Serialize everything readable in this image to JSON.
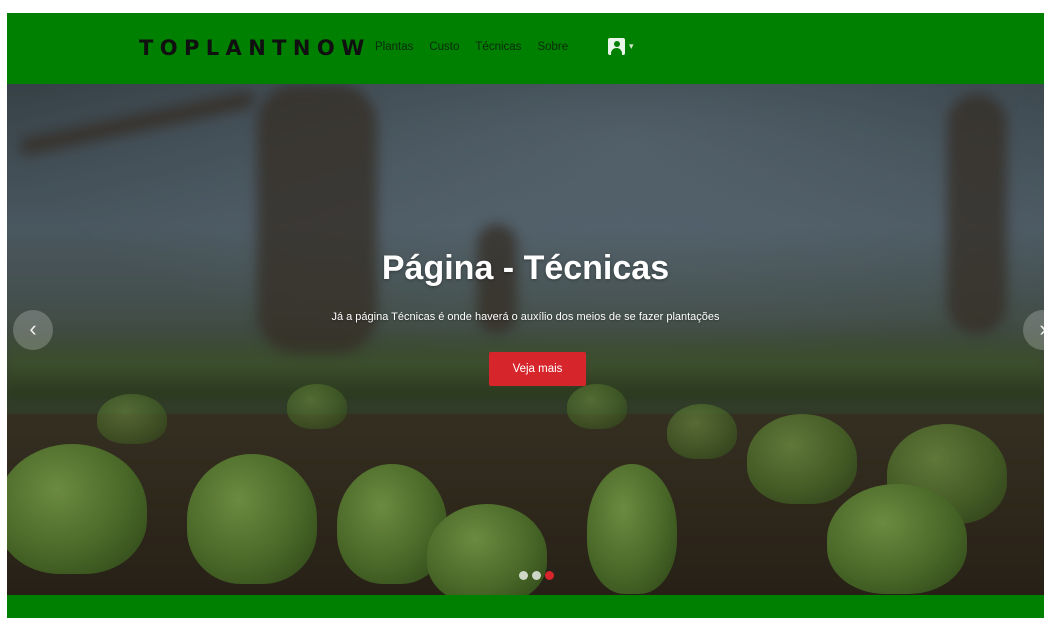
{
  "navbar": {
    "brand": "TOPLANTNOW",
    "links": [
      "Plantas",
      "Custo",
      "Técnicas",
      "Sobre"
    ],
    "user_caret": "▾",
    "background_color": "#008000"
  },
  "hero": {
    "title": "Página - Técnicas",
    "subtitle": "Já a página Técnicas é onde haverá o auxílio dos meios de se fazer plantações",
    "button_label": "Veja mais",
    "button_color": "#d6262b",
    "prev_arrow": "‹",
    "next_arrow": "›",
    "slide_count": 3,
    "active_slide": 3
  },
  "icons": {
    "user": "user-icon",
    "caret": "chevron-down-icon",
    "prev": "chevron-left-icon",
    "next": "chevron-right-icon"
  }
}
